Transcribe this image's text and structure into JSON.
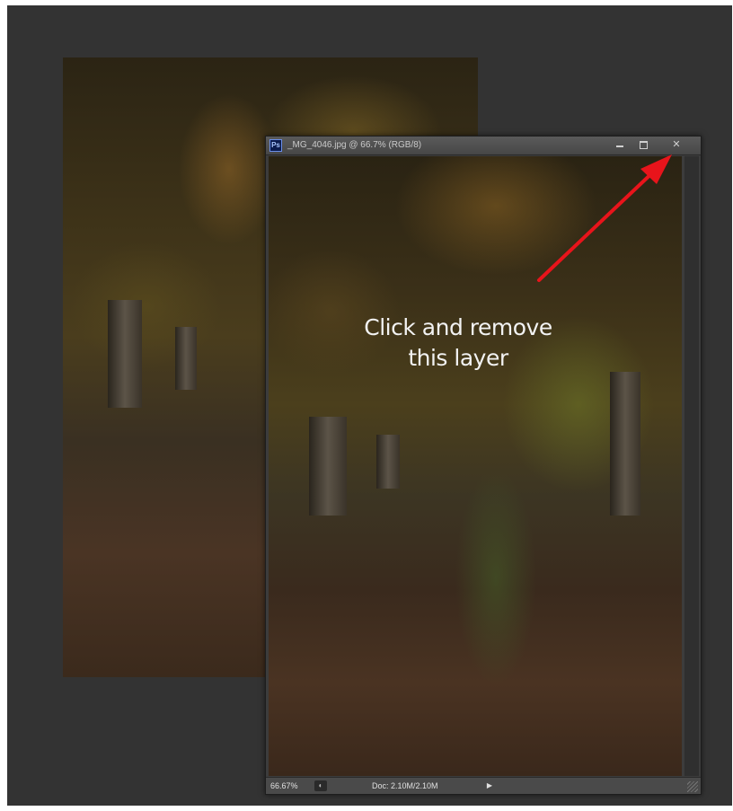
{
  "document": {
    "title": "_MG_4046.jpg @ 66.7% (RGB/8)",
    "app_icon": "Ps",
    "window_controls": {
      "minimize": "minimize-icon",
      "maximize": "maximize-icon",
      "close_glyph": "✕"
    }
  },
  "status_bar": {
    "zoom": "66.67%",
    "doc_info": "Doc: 2.10M/2.10M",
    "arrow_glyph": "▶"
  },
  "annotation": {
    "line1": "Click and remove",
    "line2": "this layer",
    "arrow_color": "#e8141b"
  },
  "colors": {
    "workspace": "#333333",
    "title_bar": "#4f4f4f",
    "status_bar": "#4a4a4a"
  }
}
